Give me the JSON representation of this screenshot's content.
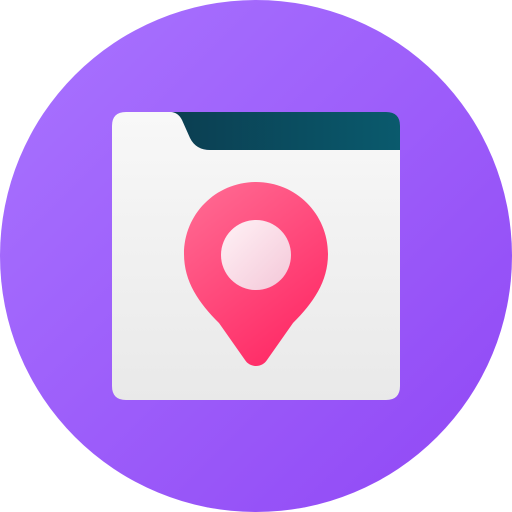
{
  "icon": {
    "name": "folder-location-pin-icon",
    "colors": {
      "circle_top": "#A974FF",
      "circle_bottom": "#9047F5",
      "folder_body_top": "#F8F8F8",
      "folder_body_bottom": "#E9E9E9",
      "folder_tab_left": "#0B3E51",
      "folder_tab_right": "#0A5A6D",
      "pin_top": "#FF6E95",
      "pin_bottom": "#FF2C67",
      "pin_center_top": "#FFF2F6",
      "pin_center_bottom": "#F4C7D8"
    }
  }
}
